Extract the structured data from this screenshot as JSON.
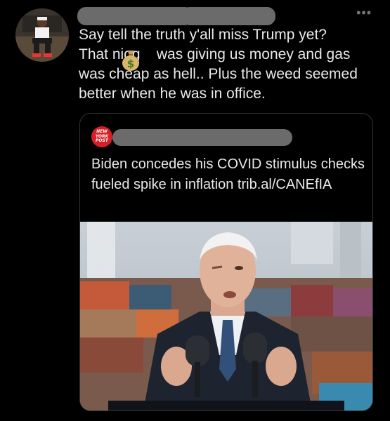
{
  "tweet": {
    "text": "Say tell the truth y'all miss Trump yet?\nThat nigg    was giving us money and gas\nwas cheap as hell.. Plus the weed seemed\nbetter when he was in office.",
    "emoji_icon": "money-bag-icon",
    "more_icon": "more-options-icon",
    "more_glyph": "•••"
  },
  "quoted_tweet": {
    "source_logo_lines": [
      "NEW",
      "YORK",
      "POST"
    ],
    "text": "Biden concedes his COVID stimulus checks fueled spike in inflation trib.al/CANEfIA"
  },
  "colors": {
    "background": "#000000",
    "text": "#e7e9ea",
    "card_border": "#2f3336",
    "redaction": "#6b6b6b",
    "nypost_red": "#d61f26"
  }
}
